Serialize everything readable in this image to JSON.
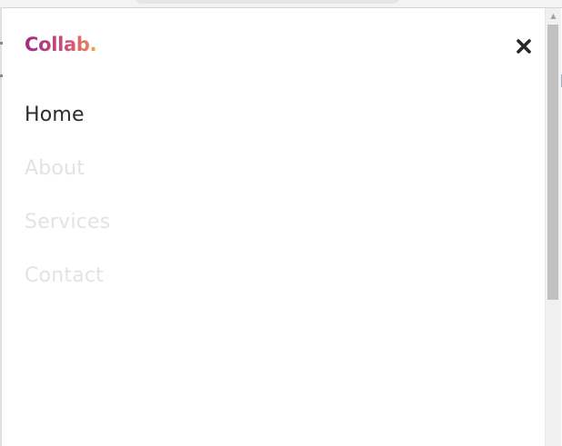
{
  "brand": {
    "name": "Collab",
    "dot": ".",
    "gradient_start": "#9c2f86",
    "gradient_end": "#f08e5a"
  },
  "menu": {
    "close_icon": "close-icon",
    "active_color": "#2b2b2b",
    "inactive_color": "#e3e3e3",
    "items": [
      {
        "label": "Home",
        "active": true
      },
      {
        "label": "About",
        "active": false
      },
      {
        "label": "Services",
        "active": false
      },
      {
        "label": "Contact",
        "active": false
      }
    ]
  },
  "scrollbar": {
    "up_arrow_icon": "scroll-up-arrow-icon"
  }
}
